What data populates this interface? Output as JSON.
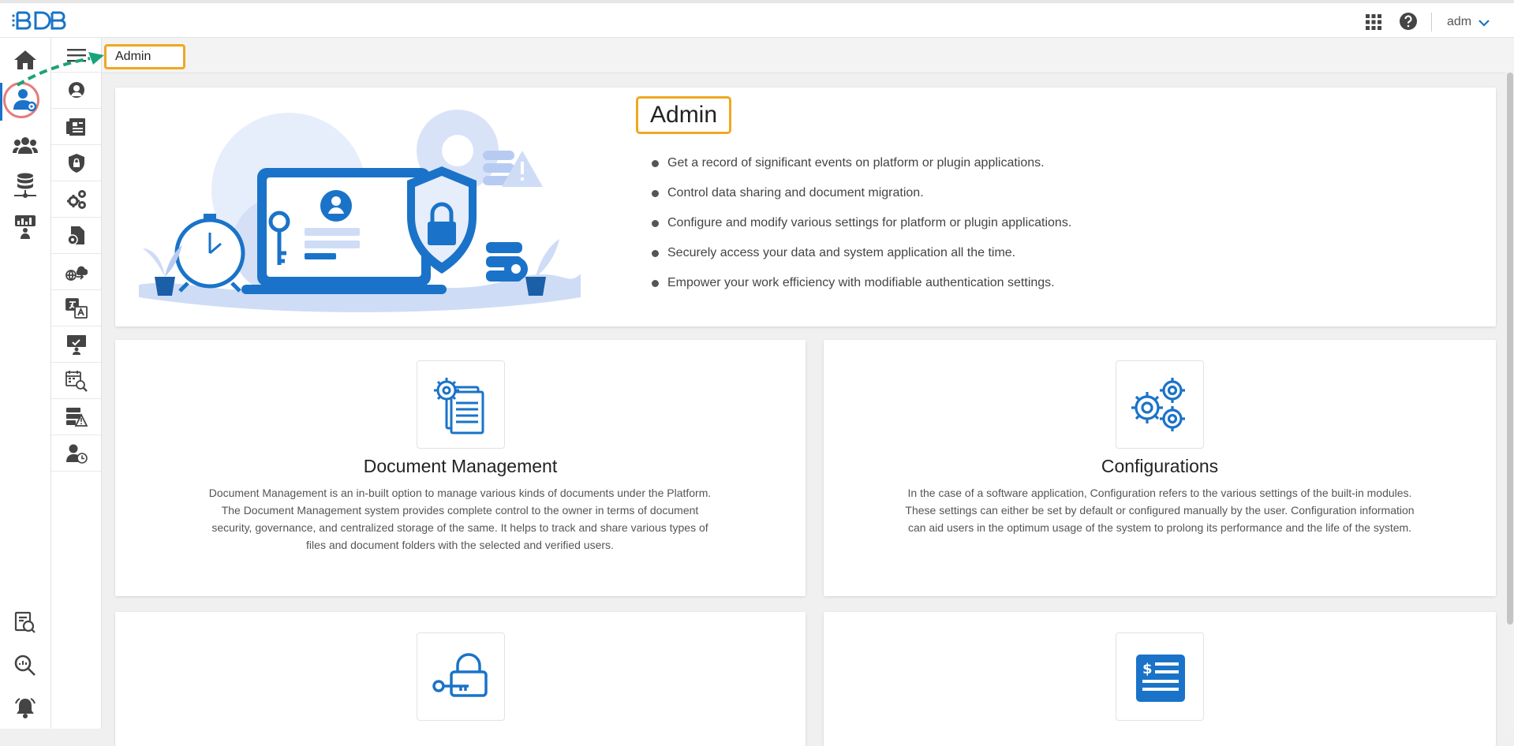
{
  "topbar": {
    "logo_text": "BDB",
    "user_name": "adm"
  },
  "rail": {
    "items": [
      "home-icon",
      "admin-icon",
      "users-icon",
      "data-center-icon",
      "dashboard-icon"
    ],
    "bottom_items": [
      "report-search-icon",
      "search-icon",
      "notification-icon"
    ]
  },
  "subrail": {
    "items": [
      "audit-trail-icon",
      "document-management-icon",
      "security-icon",
      "configurations-icon",
      "document-settings-icon",
      "api-connector-icon",
      "language-mapping-icon",
      "license-icon",
      "schedule-monitor-icon",
      "server-monitor-icon",
      "session-manager-icon"
    ]
  },
  "breadcrumb": {
    "current": "Admin"
  },
  "hero": {
    "title": "Admin",
    "bullets": [
      "Get a record of significant events on platform or plugin applications.",
      "Control data sharing and document migration.",
      "Configure and modify various settings for platform or plugin applications.",
      "Securely access your data and system application all the time.",
      "Empower your work efficiency with modifiable authentication settings."
    ]
  },
  "cards": [
    {
      "title": "Document Management",
      "description": "Document Management is an in-built option to manage various kinds of documents under the Platform. The Document Management system provides complete control to the owner in terms of document security, governance, and centralized storage of the same. It helps to track and share various types of files and document folders with the selected and verified users.",
      "icon": "document-gear-icon"
    },
    {
      "title": "Configurations",
      "description": "In the case of a software application, Configuration refers to the various settings of the built-in modules. These settings can either be set by default or configured manually by the user. Configuration information can aid users in the optimum usage of the system to prolong its performance and the life of the system.",
      "icon": "gears-icon"
    },
    {
      "title": "",
      "description": "",
      "icon": "key-lock-icon"
    },
    {
      "title": "",
      "description": "",
      "icon": "billing-icon"
    }
  ],
  "colors": {
    "accent": "#1a73c8",
    "highlight": "#f0a820",
    "annotation_arrow": "#1aa37a",
    "active_ring": "#e47d7d"
  }
}
